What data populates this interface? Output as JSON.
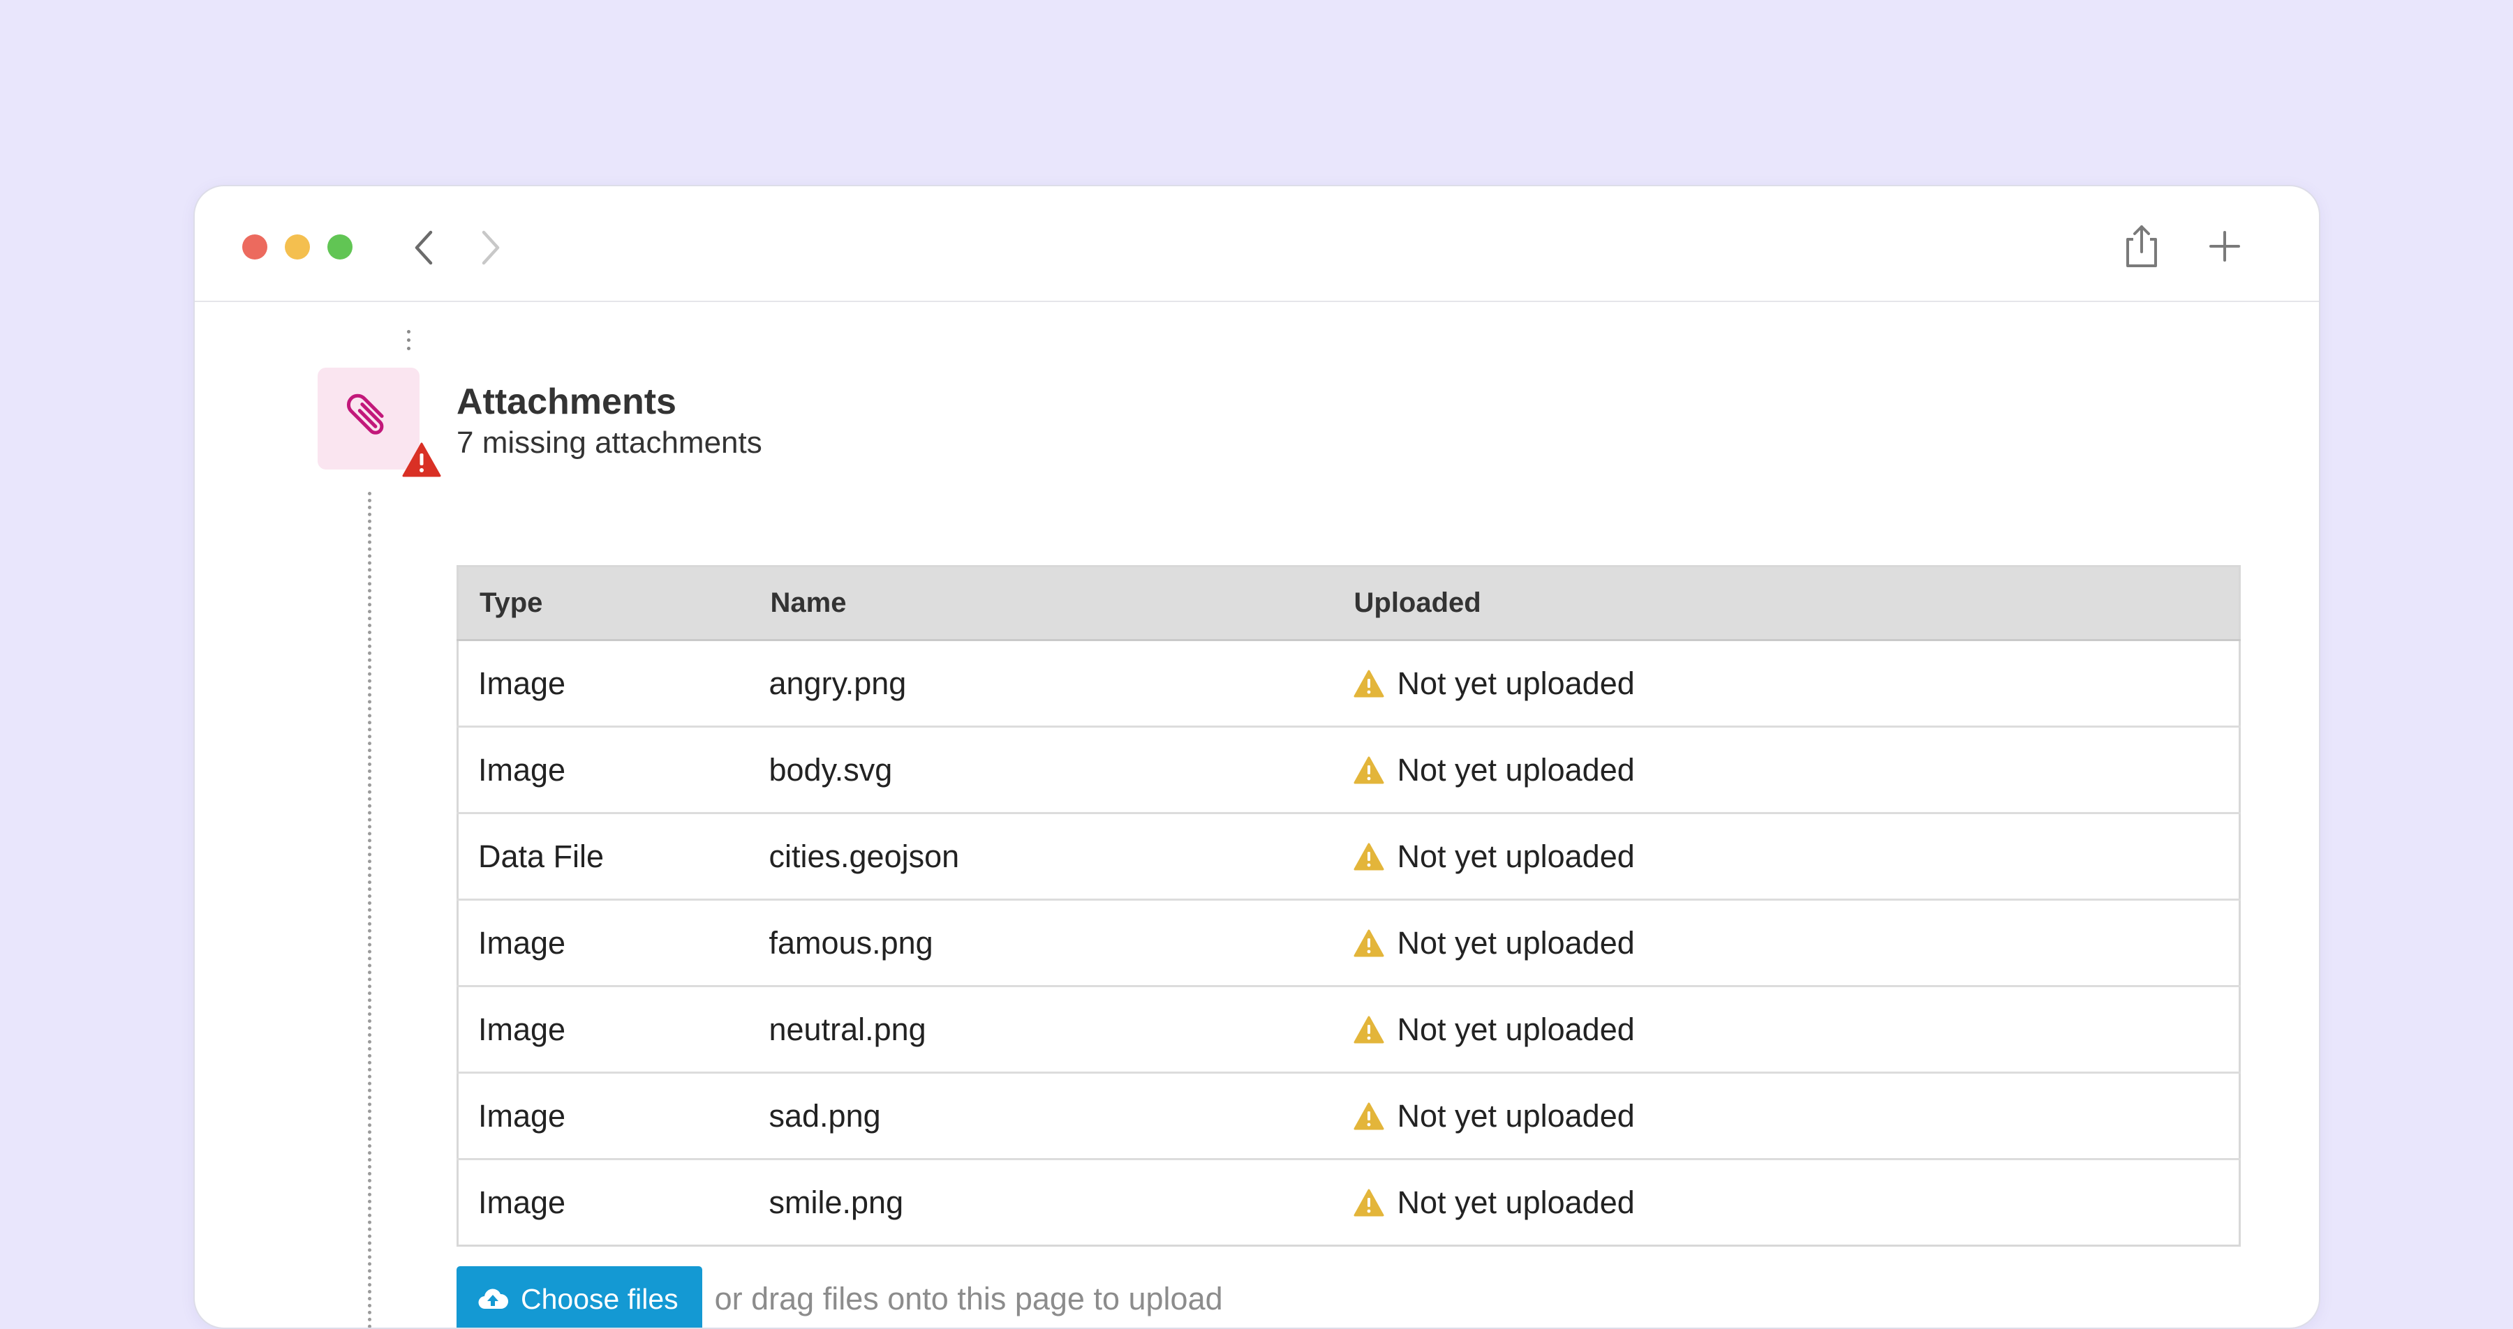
{
  "browser": {
    "back_icon": "chevron-left-icon",
    "forward_icon": "chevron-right-icon",
    "share_icon": "share-icon",
    "new_tab_icon": "plus-icon"
  },
  "attachments": {
    "icon": "paperclip-icon",
    "badge_icon": "warning-icon",
    "title": "Attachments",
    "subtitle": "7 missing attachments",
    "columns": [
      "Type",
      "Name",
      "Uploaded"
    ],
    "rows": [
      {
        "type": "Image",
        "name": "angry.png",
        "status": "Not yet uploaded"
      },
      {
        "type": "Image",
        "name": "body.svg",
        "status": "Not yet uploaded"
      },
      {
        "type": "Data File",
        "name": "cities.geojson",
        "status": "Not yet uploaded"
      },
      {
        "type": "Image",
        "name": "famous.png",
        "status": "Not yet uploaded"
      },
      {
        "type": "Image",
        "name": "neutral.png",
        "status": "Not yet uploaded"
      },
      {
        "type": "Image",
        "name": "sad.png",
        "status": "Not yet uploaded"
      },
      {
        "type": "Image",
        "name": "smile.png",
        "status": "Not yet uploaded"
      }
    ],
    "upload": {
      "button_label": "Choose files",
      "button_icon": "cloud-upload-icon",
      "hint": "or drag files onto this page to upload"
    }
  },
  "colors": {
    "background": "#e9e6fc",
    "accent": "#1499d3",
    "warning": "#e3b53a",
    "error": "#d93025",
    "paperclip": "#c2187a"
  }
}
